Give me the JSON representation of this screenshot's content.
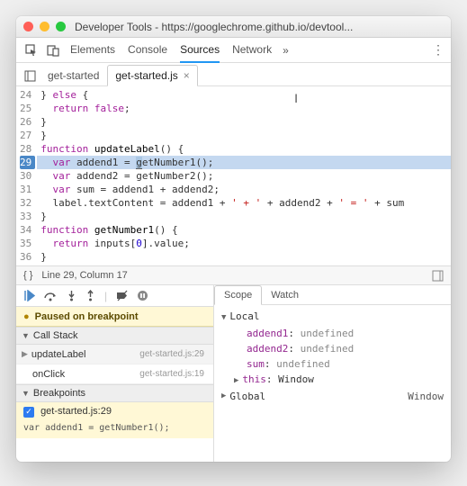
{
  "window": {
    "title": "Developer Tools - https://googlechrome.github.io/devtool..."
  },
  "main_tabs": [
    "Elements",
    "Console",
    "Sources",
    "Network"
  ],
  "main_tab_active": "Sources",
  "file_tabs": [
    {
      "label": "get-started",
      "active": false
    },
    {
      "label": "get-started.js",
      "active": true
    }
  ],
  "code": {
    "lines": [
      {
        "n": 24,
        "text_html": "} <span class='kw'>else</span> {"
      },
      {
        "n": 25,
        "text_html": "  <span class='kw'>return</span> <span class='kw'>false</span>;"
      },
      {
        "n": 26,
        "text_html": "}"
      },
      {
        "n": 27,
        "text_html": "}"
      },
      {
        "n": 28,
        "text_html": "<span class='kw'>function</span> <span class='fn'>updateLabel</span>() {"
      },
      {
        "n": 29,
        "text_html": "  <span class='kw'>var</span> addend1 = <span class='step-sel'>g</span>etNumber1();",
        "breakpoint": true,
        "highlight": true
      },
      {
        "n": 30,
        "text_html": "  <span class='kw'>var</span> addend2 = getNumber2();"
      },
      {
        "n": 31,
        "text_html": "  <span class='kw'>var</span> sum = addend1 + addend2;"
      },
      {
        "n": 32,
        "text_html": "  label.textContent = addend1 + <span class='str'>' + '</span> + addend2 + <span class='str'>' = '</span> + sum"
      },
      {
        "n": 33,
        "text_html": "}"
      },
      {
        "n": 34,
        "text_html": "<span class='kw'>function</span> <span class='fn'>getNumber1</span>() {"
      },
      {
        "n": 35,
        "text_html": "  <span class='kw'>return</span> inputs[<span class='num'>0</span>].value;"
      },
      {
        "n": 36,
        "text_html": "}"
      }
    ]
  },
  "status": {
    "position": "Line 29, Column 17"
  },
  "paused_msg": "Paused on breakpoint",
  "sections": {
    "call_stack": "Call Stack",
    "breakpoints": "Breakpoints"
  },
  "call_stack": [
    {
      "fn": "updateLabel",
      "loc": "get-started.js:29",
      "current": true
    },
    {
      "fn": "onClick",
      "loc": "get-started.js:19",
      "current": false
    }
  ],
  "breakpoint_item": {
    "label": "get-started.js:29",
    "code": "var addend1 = getNumber1();"
  },
  "scope_tabs": [
    "Scope",
    "Watch"
  ],
  "scope_tab_active": "Scope",
  "scope": {
    "local_label": "Local",
    "vars": [
      {
        "name": "addend1",
        "value": "undefined"
      },
      {
        "name": "addend2",
        "value": "undefined"
      },
      {
        "name": "sum",
        "value": "undefined"
      }
    ],
    "this_label": "this",
    "this_value": "Window",
    "global_label": "Global",
    "global_value": "Window"
  }
}
